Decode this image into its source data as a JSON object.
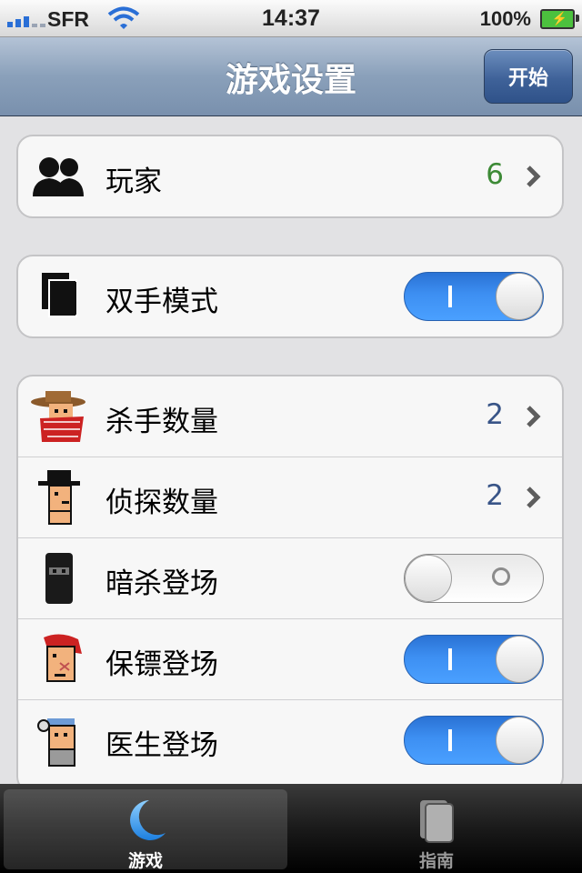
{
  "status": {
    "carrier": "SFR",
    "time": "14:37",
    "battery": "100%",
    "signal_bars": 5
  },
  "nav": {
    "title": "游戏设置",
    "start_button": "开始"
  },
  "groups": {
    "players": {
      "label": "玩家",
      "value": "6",
      "value_color": "#3d8a36"
    },
    "two_hand": {
      "label": "双手模式",
      "switch_on": true
    },
    "roles": [
      {
        "label": "杀手数量",
        "value": "2",
        "icon": "killer-icon"
      },
      {
        "label": "侦探数量",
        "value": "2",
        "icon": "detective-icon"
      },
      {
        "label": "暗杀登场",
        "switch_on": false,
        "icon": "assassin-icon"
      },
      {
        "label": "保镖登场",
        "switch_on": true,
        "icon": "bodyguard-icon"
      },
      {
        "label": "医生登场",
        "switch_on": true,
        "icon": "doctor-icon"
      }
    ]
  },
  "tabs": [
    {
      "label": "游戏",
      "icon": "moon-icon",
      "active": true
    },
    {
      "label": "指南",
      "icon": "book-icon",
      "active": false
    }
  ],
  "colors": {
    "accent_blue": "#3d8ff2",
    "nav_bar": "#8aa0ba",
    "value_blue": "#385487"
  }
}
